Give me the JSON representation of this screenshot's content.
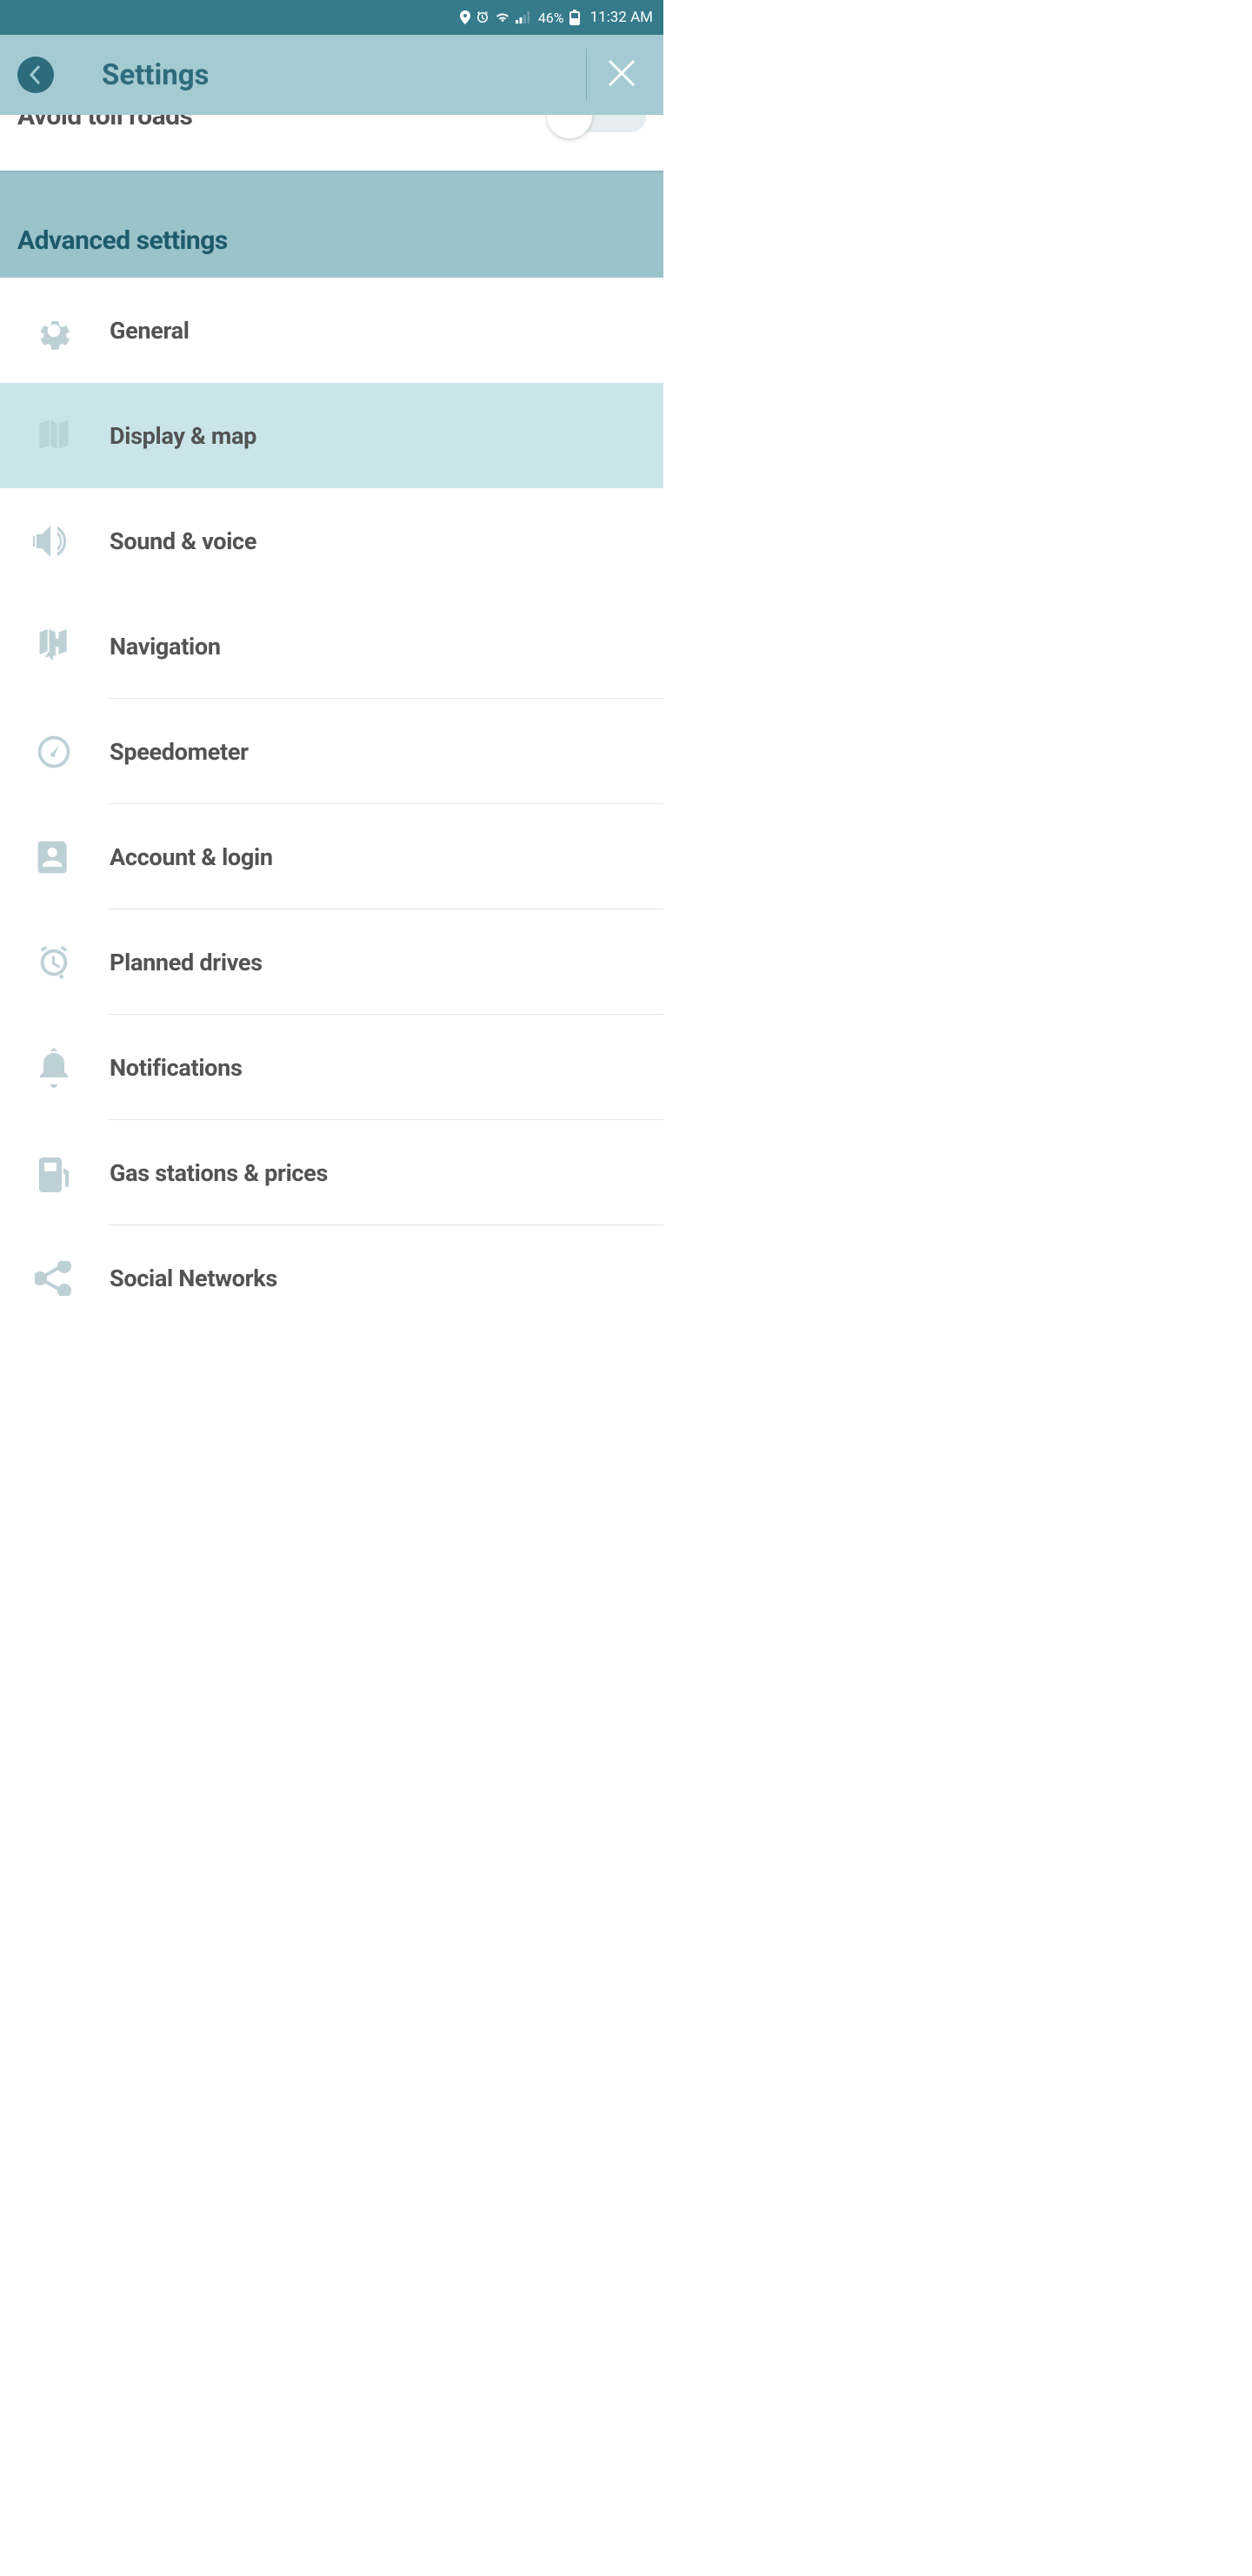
{
  "status_bar": {
    "battery_pct": "46%",
    "time": "11:32 AM"
  },
  "header": {
    "title": "Settings"
  },
  "partial_row": {
    "label": "Avoid toll roads"
  },
  "section": {
    "title": "Advanced settings"
  },
  "items": [
    {
      "id": "general",
      "label": "General",
      "icon": "gear",
      "selected": false
    },
    {
      "id": "display-map",
      "label": "Display & map",
      "icon": "map",
      "selected": true
    },
    {
      "id": "sound-voice",
      "label": "Sound & voice",
      "icon": "sound",
      "selected": false
    },
    {
      "id": "navigation",
      "label": "Navigation",
      "icon": "nav",
      "selected": false
    },
    {
      "id": "speedometer",
      "label": "Speedometer",
      "icon": "speedo",
      "selected": false
    },
    {
      "id": "account-login",
      "label": "Account & login",
      "icon": "account",
      "selected": false
    },
    {
      "id": "planned-drives",
      "label": "Planned drives",
      "icon": "clock",
      "selected": false
    },
    {
      "id": "notifications",
      "label": "Notifications",
      "icon": "bell",
      "selected": false
    },
    {
      "id": "gas-stations",
      "label": "Gas stations & prices",
      "icon": "gas",
      "selected": false
    },
    {
      "id": "social-networks",
      "label": "Social Networks",
      "icon": "share",
      "selected": false
    }
  ]
}
